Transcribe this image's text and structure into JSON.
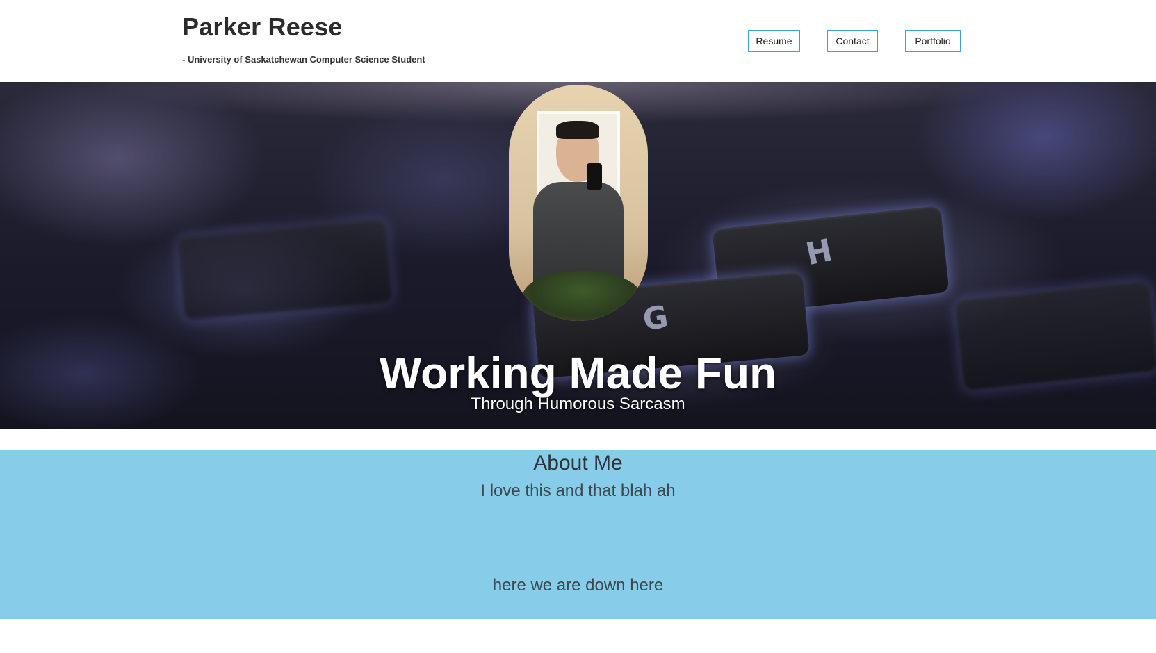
{
  "header": {
    "title": "Parker Reese",
    "subtitle": "- University of Saskatchewan Computer Science Student",
    "nav": {
      "resume": "Resume",
      "contact": "Contact",
      "portfolio": "Portfolio"
    }
  },
  "hero": {
    "title": "Working Made Fun",
    "subtitle": "Through Humorous Sarcasm",
    "background_image": "keyboard-keys-photo",
    "profile_image": "profile-selfie-photo",
    "key_labels": [
      "H",
      "G"
    ]
  },
  "about": {
    "heading": "About Me",
    "text": "I love this and that blah ah",
    "footer_text": "here we are down here"
  },
  "colors": {
    "nav_border": "#3aa3dc",
    "about_background": "#87cce9",
    "hero_text": "#ffffff"
  }
}
